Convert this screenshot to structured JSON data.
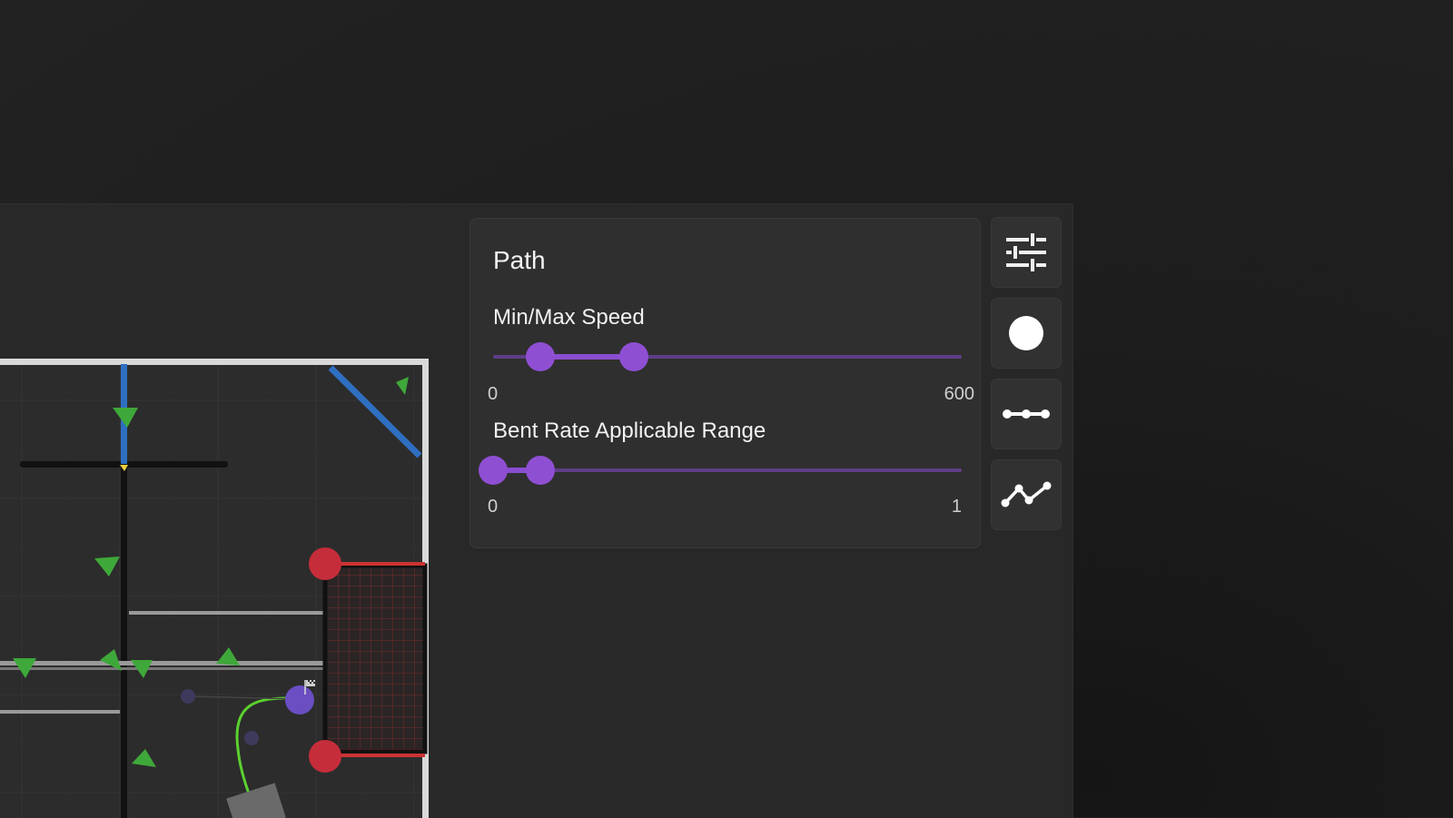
{
  "panel": {
    "title": "Path",
    "speed": {
      "label": "Min/Max Speed",
      "min_label": "0",
      "max_label": "600",
      "min_value": 60,
      "max_value": 180,
      "range": [
        0,
        600
      ]
    },
    "bent_rate": {
      "label": "Bent Rate Applicable Range",
      "min_label": "0",
      "max_label": "1",
      "low_value": 0.0,
      "high_value": 0.1,
      "range": [
        0,
        1
      ]
    }
  },
  "toolbar": {
    "buttons": [
      {
        "name": "settings-sliders",
        "icon": "sliders-icon"
      },
      {
        "name": "point-tool",
        "icon": "circle-icon"
      },
      {
        "name": "segment-tool",
        "icon": "segment-icon"
      },
      {
        "name": "path-tool",
        "icon": "polyline-icon"
      }
    ]
  },
  "colors": {
    "accent": "#8f4fd3",
    "track": "#5e3d87",
    "field_bg": "#2d2d2d"
  }
}
